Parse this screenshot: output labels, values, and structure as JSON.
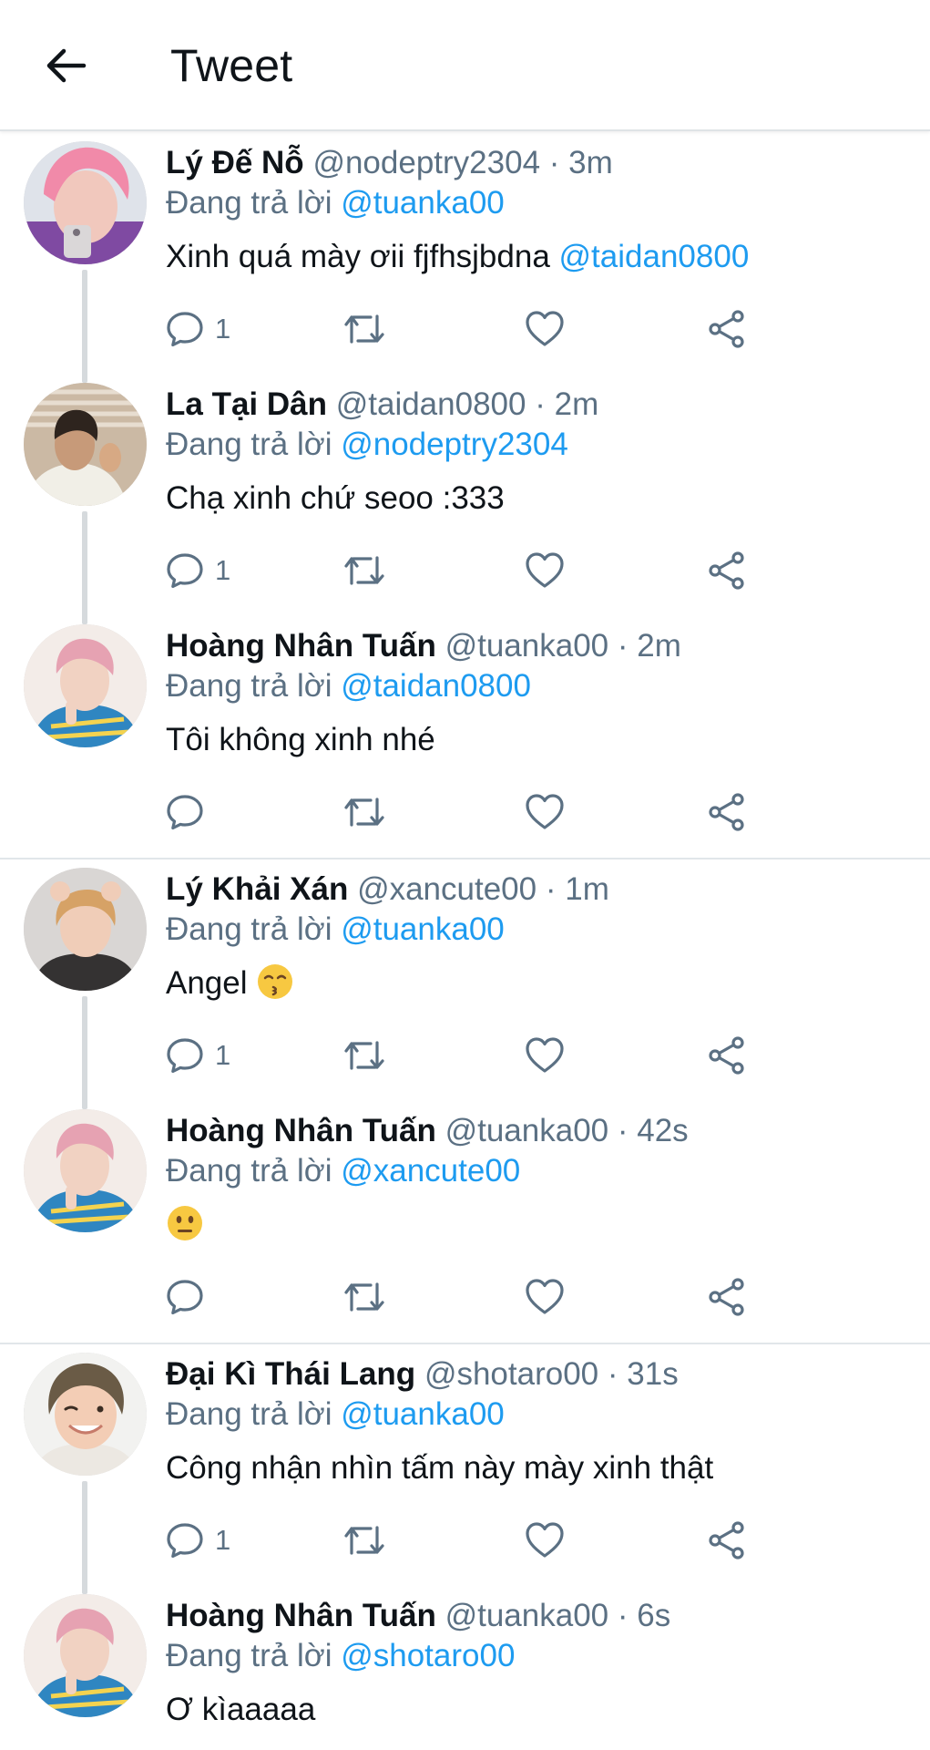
{
  "header": {
    "title": "Tweet",
    "back_icon": "arrow-left-icon"
  },
  "colors": {
    "link": "#1d9bf0",
    "secondary_text": "#5b7083",
    "primary_text": "#0f1419",
    "divider": "#e1e6ea"
  },
  "icons": {
    "reply": "speech-bubble-icon",
    "retweet": "retweet-icon",
    "like": "heart-icon",
    "share": "share-icon",
    "more": "vertical-dots-icon"
  },
  "threads": [
    {
      "tweets": [
        {
          "author": "Lý Đế Nỗ",
          "handle": "@nodeptry2304",
          "dot": "·",
          "time": "3m",
          "reply_label": "Đang trả lời",
          "reply_to": "@tuanka00",
          "text": "Xinh quá mày ơii fjfhsjbdna",
          "text_mention": "@taidan0800",
          "reply_count": "1"
        },
        {
          "author": "La Tại Dân",
          "handle": "@taidan0800",
          "dot": "·",
          "time": "2m",
          "reply_label": "Đang trả lời",
          "reply_to": "@nodeptry2304",
          "text": "Chạ xinh chứ seoo :333",
          "reply_count": "1"
        },
        {
          "author": "Hoàng Nhân Tuấn",
          "handle": "@tuanka00",
          "dot": "·",
          "time": "2m",
          "reply_label": "Đang trả lời",
          "reply_to": "@taidan0800",
          "text": "Tôi không xinh nhé",
          "reply_count": ""
        }
      ]
    },
    {
      "tweets": [
        {
          "author": "Lý Khải Xán",
          "handle": "@xancute00",
          "dot": "·",
          "time": "1m",
          "reply_label": "Đang trả lời",
          "reply_to": "@tuanka00",
          "text": "Angel",
          "emoji": "kissing-smiling-eyes-emoji",
          "reply_count": "1"
        },
        {
          "author": "Hoàng Nhân Tuấn",
          "handle": "@tuanka00",
          "dot": "·",
          "time": "42s",
          "reply_label": "Đang trả lời",
          "reply_to": "@xancute00",
          "text": "",
          "emoji": "neutral-face-emoji",
          "reply_count": ""
        }
      ]
    },
    {
      "tweets": [
        {
          "author": "Đại Kì Thái Lang",
          "handle": "@shotaro00",
          "dot": "·",
          "time": "31s",
          "reply_label": "Đang trả lời",
          "reply_to": "@tuanka00",
          "text": "Công nhận nhìn tấm này mày xinh thật",
          "reply_count": "1"
        },
        {
          "author": "Hoàng Nhân Tuấn",
          "handle": "@tuanka00",
          "dot": "·",
          "time": "6s",
          "reply_label": "Đang trả lời",
          "reply_to": "@shotaro00",
          "text": "Ơ kìaaaaa"
        }
      ]
    }
  ]
}
